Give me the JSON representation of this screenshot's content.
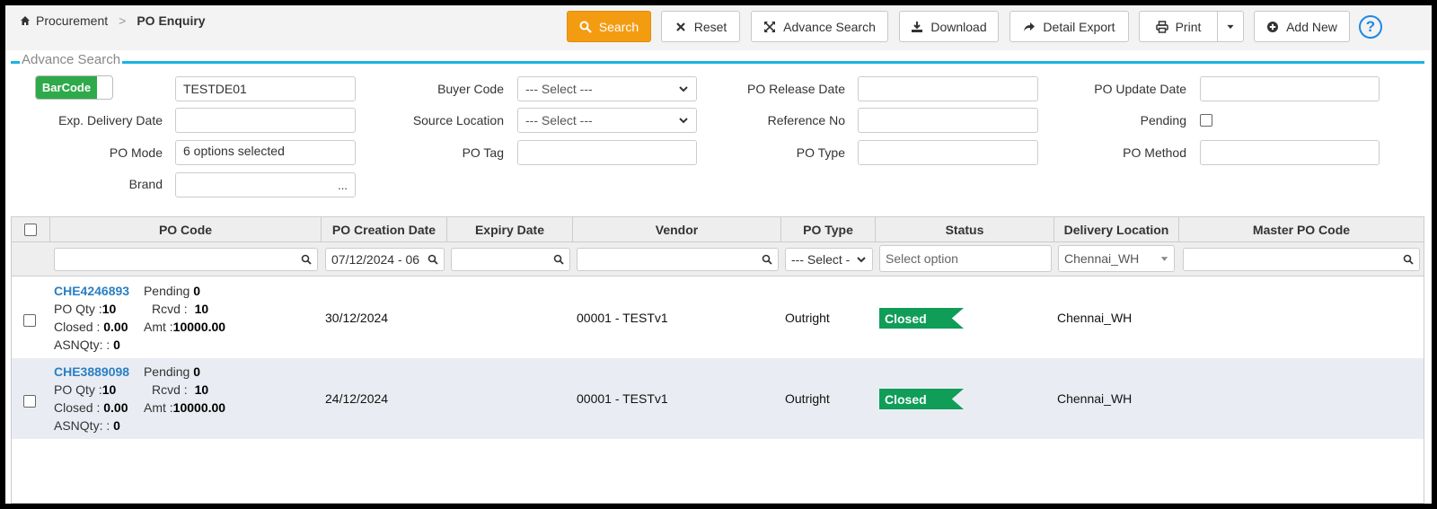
{
  "breadcrumb": {
    "root": "Procurement",
    "separator": ">",
    "current": "PO Enquiry"
  },
  "toolbar": {
    "search": "Search",
    "reset": "Reset",
    "advance_search": "Advance Search",
    "download": "Download",
    "detail_export": "Detail Export",
    "print": "Print",
    "add_new": "Add New",
    "help": "?"
  },
  "advance_search": {
    "legend": "Advance Search",
    "barcode_toggle": "BarCode",
    "barcode_value": "TESTDE01",
    "exp_delivery_date_label": "Exp. Delivery Date",
    "po_mode_label": "PO Mode",
    "po_mode_value": "6 options selected",
    "brand_label": "Brand",
    "brand_button": "...",
    "buyer_code_label": "Buyer Code",
    "buyer_code_value": "--- Select ---",
    "source_location_label": "Source Location",
    "source_location_value": "--- Select ---",
    "po_tag_label": "PO Tag",
    "po_release_date_label": "PO Release Date",
    "reference_no_label": "Reference No",
    "po_type_label": "PO Type",
    "po_update_date_label": "PO Update Date",
    "pending_label": "Pending",
    "po_method_label": "PO Method"
  },
  "grid": {
    "columns": [
      "PO Code",
      "PO Creation Date",
      "Expiry Date",
      "Vendor",
      "PO Type",
      "Status",
      "Delivery Location",
      "Master PO Code"
    ],
    "filters": {
      "po_creation_date": "07/12/2024 - 06",
      "po_type": "--- Select -",
      "status": "Select option",
      "delivery_location": "Chennai_WH"
    },
    "rows": [
      {
        "po_code": "CHE4246893",
        "pending_label": "Pending",
        "pending": "0",
        "po_qty_label": "PO Qty :",
        "po_qty": "10",
        "rcvd_label": "Rcvd :",
        "rcvd": "10",
        "closed_label": "Closed :",
        "closed": "0.00",
        "amt_label": "Amt :",
        "amt": "10000.00",
        "asn_label": "ASNQty: :",
        "asn": "0",
        "creation_date": "30/12/2024",
        "vendor": "00001 - TESTv1",
        "po_type": "Outright",
        "status": "Closed",
        "delivery_location": "Chennai_WH"
      },
      {
        "po_code": "CHE3889098",
        "pending_label": "Pending",
        "pending": "0",
        "po_qty_label": "PO Qty :",
        "po_qty": "10",
        "rcvd_label": "Rcvd :",
        "rcvd": "10",
        "closed_label": "Closed :",
        "closed": "0.00",
        "amt_label": "Amt :",
        "amt": "10000.00",
        "asn_label": "ASNQty: :",
        "asn": "0",
        "creation_date": "24/12/2024",
        "vendor": "00001 - TESTv1",
        "po_type": "Outright",
        "status": "Closed",
        "delivery_location": "Chennai_WH"
      }
    ]
  },
  "colors": {
    "accent": "#f39c12",
    "link": "#2a7fc4",
    "status_closed": "#0f9d58",
    "legend_line": "#1ab3e0",
    "toggle_on": "#2eaa4a"
  }
}
